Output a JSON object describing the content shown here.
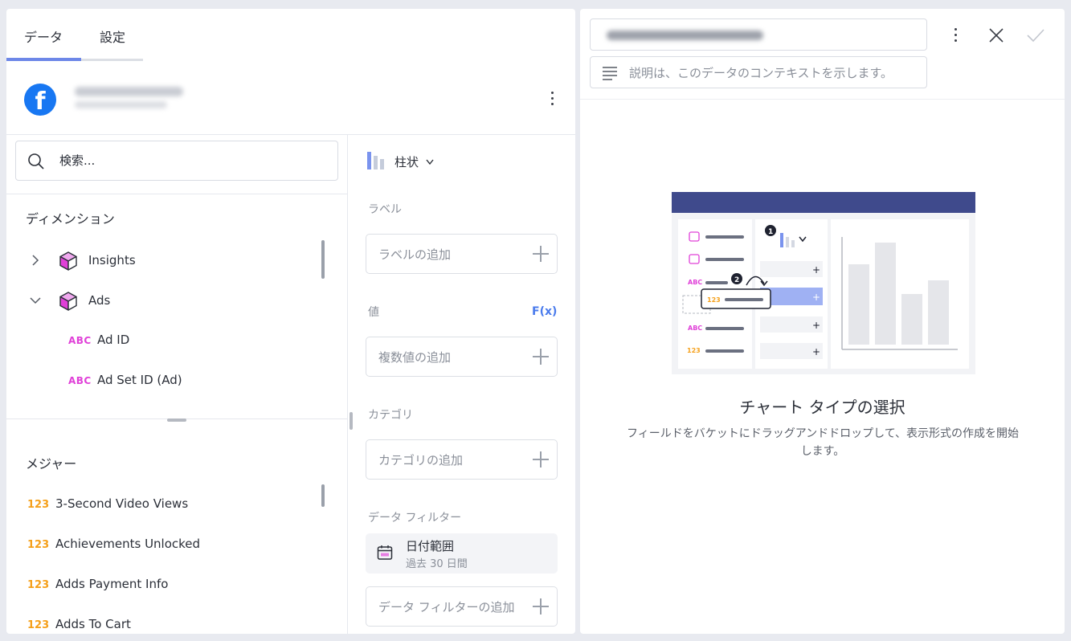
{
  "tabs": {
    "data": "データ",
    "settings": "設定",
    "active": "data"
  },
  "source": {
    "icon": "facebook-icon"
  },
  "search": {
    "placeholder": "検索..."
  },
  "dimensions": {
    "title": "ディメンション",
    "items": [
      {
        "label": "Insights",
        "expanded": false
      },
      {
        "label": "Ads",
        "expanded": true
      }
    ],
    "ads_fields": [
      {
        "type": "ABC",
        "label": "Ad ID"
      },
      {
        "type": "ABC",
        "label": "Ad Set ID (Ad)"
      }
    ]
  },
  "measures": {
    "title": "メジャー",
    "items": [
      {
        "type": "123",
        "label": "3-Second Video Views"
      },
      {
        "type": "123",
        "label": "Achievements Unlocked"
      },
      {
        "type": "123",
        "label": "Adds Payment Info"
      },
      {
        "type": "123",
        "label": "Adds To Cart"
      }
    ]
  },
  "config": {
    "chart_type": "柱状",
    "label_title": "ラベル",
    "label_add": "ラベルの追加",
    "values_title": "値",
    "fx": "F(x)",
    "values_add": "複数値の追加",
    "category_title": "カテゴリ",
    "category_add": "カテゴリの追加",
    "filter_title": "データ フィルター",
    "date_filter": {
      "name": "日付範囲",
      "value": "過去 30 日間"
    },
    "filter_add": "データ フィルターの追加"
  },
  "right": {
    "description_placeholder": "説明は、このデータのコンテキストを示します。",
    "empty_title": "チャート タイプの選択",
    "empty_desc": "フィールドをバケットにドラッグアンドドロップして、表示形式の作成を開始します。"
  },
  "illustration": {
    "mini_abc": "ABC",
    "mini_123": "123",
    "step1": "1",
    "step2": "2"
  },
  "colors": {
    "accent": "#4a7bec",
    "tab_indicator": "#6d87e8",
    "facebook": "#1877f2",
    "abc": "#e040d8",
    "num": "#f5a01a",
    "illustration_header": "#3f4a8c"
  }
}
